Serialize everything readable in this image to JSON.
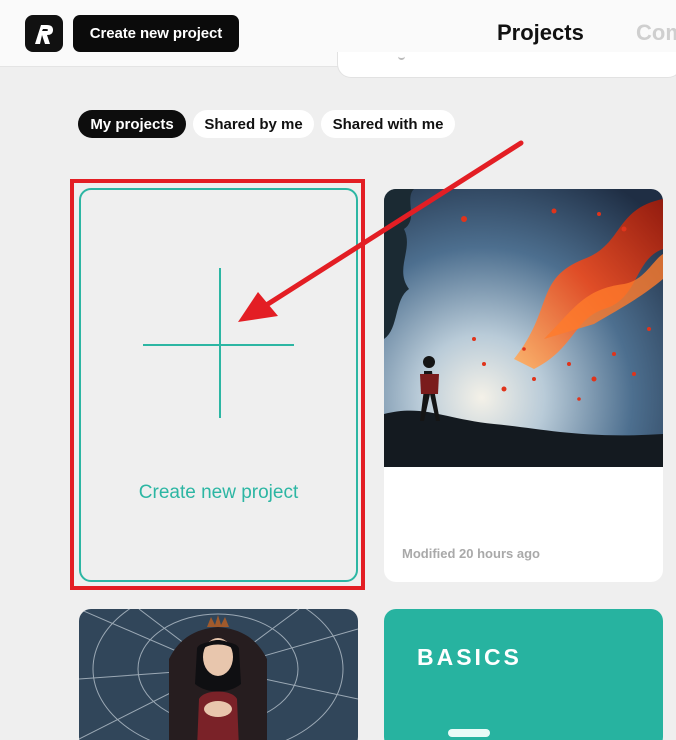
{
  "header": {
    "create_button_label": "Create new project",
    "nav_projects_label": "Projects",
    "nav_next_label": "Com"
  },
  "filters": [
    {
      "label": "My projects",
      "active": true
    },
    {
      "label": "Shared by me",
      "active": false
    },
    {
      "label": "Shared with me",
      "active": false
    }
  ],
  "create_card": {
    "label": "Create new project"
  },
  "projects": [
    {
      "thumbnail": "silhouette-figure-with-red-leaves-storm",
      "modified": "Modified 20 hours ago"
    },
    {
      "thumbnail": "woman-on-throne-with-spiderweb"
    },
    {
      "thumbnail": "basics-template",
      "title": "BASICS"
    }
  ],
  "colors": {
    "accent": "#2cb6a3",
    "annotation": "#e31e24",
    "primary_button": "#0b0b0b",
    "basics_card": "#27b3a0"
  }
}
